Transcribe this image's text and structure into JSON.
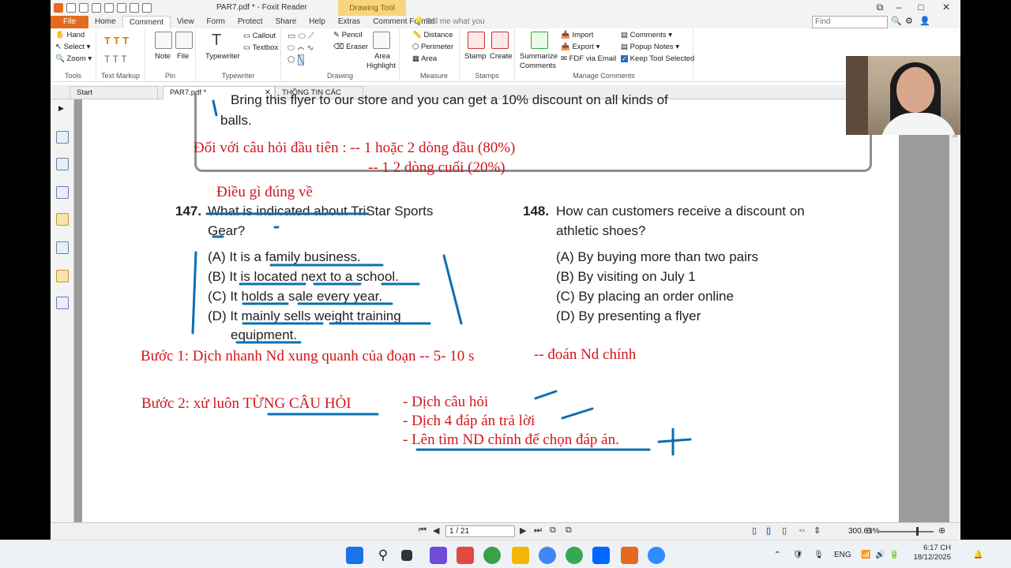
{
  "window": {
    "title": "PAR7.pdf * - Foxit Reader",
    "context_tab": "Drawing Tool",
    "tell_me_placeholder": "Tell me what you",
    "find_placeholder": "Find"
  },
  "ribbon_tabs": [
    "File",
    "Home",
    "Comment",
    "View",
    "Form",
    "Protect",
    "Share",
    "Help",
    "Extras",
    "Comment Format"
  ],
  "active_ribbon_tab": "Comment",
  "ribbon": {
    "tools": {
      "hand": "Hand",
      "select": "Select",
      "zoom": "Zoom",
      "label": "Tools"
    },
    "text_markup": {
      "label": "Text Markup"
    },
    "pin": {
      "note": "Note",
      "file": "File",
      "label": "Pin"
    },
    "typewriter": {
      "typewriter": "Typewriter",
      "callout": "Callout",
      "textbox": "Textbox",
      "label": "Typewriter"
    },
    "drawing": {
      "pencil": "Pencil",
      "eraser": "Eraser",
      "area_highlight_1": "Area",
      "area_highlight_2": "Highlight",
      "label": "Drawing"
    },
    "measure": {
      "distance": "Distance",
      "perimeter": "Perimeter",
      "area": "Area",
      "label": "Measure"
    },
    "stamps": {
      "stamp": "Stamp",
      "create": "Create",
      "label": "Stamps"
    },
    "manage": {
      "summarize_1": "Summarize",
      "summarize_2": "Comments",
      "import": "Import",
      "export": "Export",
      "fdf_email": "FDF via Email",
      "comments": "Comments",
      "popup_notes": "Popup Notes",
      "keep_tool": "Keep Tool Selected",
      "label": "Manage Comments"
    }
  },
  "doc_tabs": [
    "Start",
    "PAR7.pdf *",
    "THÔNG TIN CÁC KHÓ..."
  ],
  "document": {
    "flyer_line": "Bring this flyer to our store and you can get a 10% discount on all kinds of",
    "flyer_line2": "balls.",
    "note_first_q": "Đối với câu hỏi đầu tiên : -- 1 hoặc 2 dòng đầu (80%)",
    "note_first_q2": "-- 1 2 dòng cuối (20%)",
    "note_147": "Điều gì đúng về",
    "q147_num": "147.",
    "q147_text_a": "What is indicated about TriStar Sports",
    "q147_text_b": "Gear?",
    "q147_options": [
      "(A) It is a family business.",
      "(B) It is located next to a school.",
      "(C) It holds a sale every year.",
      "(D) It mainly sells weight training",
      "equipment."
    ],
    "q148_num": "148.",
    "q148_text_a": "How can customers receive a discount on",
    "q148_text_b": "athletic shoes?",
    "q148_options": [
      "(A) By buying more than two pairs",
      "(B) By visiting on July 1",
      "(C) By placing an order online",
      "(D) By presenting a flyer"
    ],
    "step1": "Bước 1: Dịch nhanh Nd xung quanh của đoạn -- 5- 10 s",
    "step1_b": "-- đoán Nd chính",
    "step2": "Bước 2: xử luôn TỪNG CÂU HỎI",
    "step2_items": [
      "- Dịch câu hỏi",
      "- Dịch 4 đáp án trả lời",
      "- Lên tìm ND chính để chọn đáp án."
    ]
  },
  "status": {
    "page_indicator": "1 / 21",
    "zoom": "300.61%"
  },
  "taskbar": {
    "lang": "ENG",
    "time": "6:17 CH",
    "date": "18/12/2025"
  },
  "colors": {
    "accent_orange": "#e46b1d",
    "annotation_red": "#d4161c",
    "ink_blue": "#0a6fb0"
  }
}
